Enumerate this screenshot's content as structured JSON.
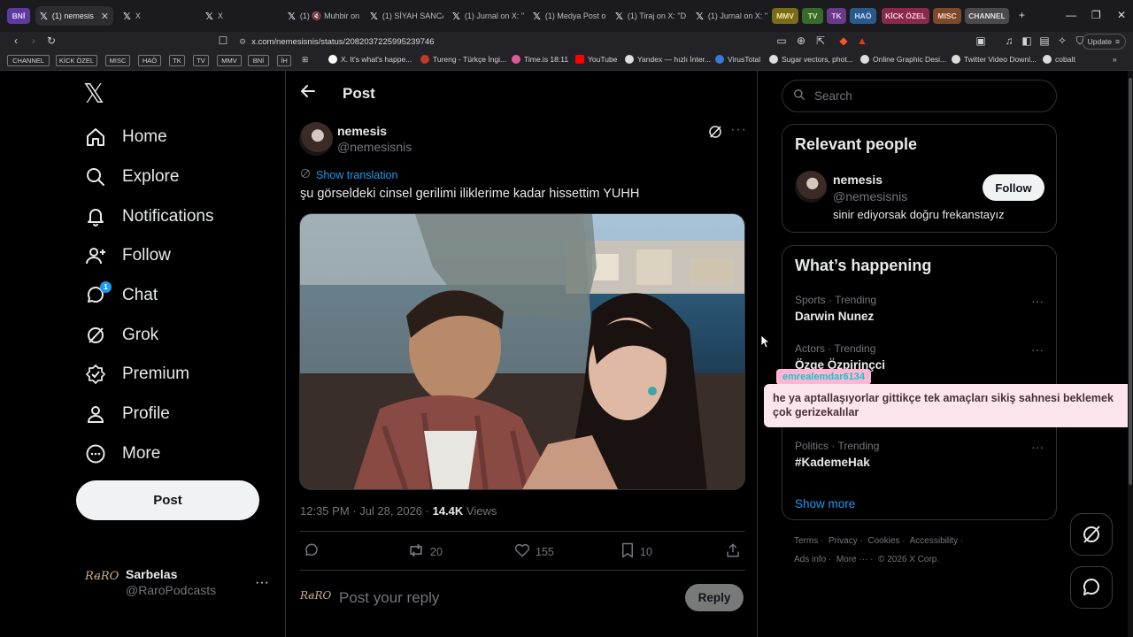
{
  "browser": {
    "tabs": [
      {
        "label": "BNİ",
        "kind": "chip",
        "color": "#5c3b9c"
      },
      {
        "label": "(1) nemesis",
        "active": true
      },
      {
        "label": "X"
      },
      {
        "label": "X"
      },
      {
        "label": "(1) 🔇 Muhbir on"
      },
      {
        "label": "(1) SİYAH SANCA"
      },
      {
        "label": "(1) Jurnal on X: \""
      },
      {
        "label": "(1) Medya Post o"
      },
      {
        "label": "(1) Tiraj on X: \"D"
      },
      {
        "label": "(1) Jurnal on X: \""
      }
    ],
    "group_chips": [
      {
        "label": "MMV",
        "color": "#7a6a1c"
      },
      {
        "label": "TV",
        "color": "#3a6a2a"
      },
      {
        "label": "TK",
        "color": "#6a3a8a"
      },
      {
        "label": "HAÖ",
        "color": "#2a5a8a"
      },
      {
        "label": "KİCK ÖZEL",
        "color": "#8a2a4a"
      },
      {
        "label": "MISC",
        "color": "#7a4a2a"
      },
      {
        "label": "CHANNEL",
        "color": "#4a4a4e"
      }
    ],
    "url": "x.com/nemesisnis/status/2082037225995239746",
    "update_label": "Update",
    "bookmark_chips": [
      "CHANNEL",
      "KİCK ÖZEL",
      "MISC",
      "HAÖ",
      "TK",
      "TV",
      "MMV",
      "BNİ",
      "İH"
    ],
    "bookmarks": [
      {
        "label": "X. It's what's happe...",
        "color": "#ffffff"
      },
      {
        "label": "Tureng - Türkçe İngi...",
        "color": "#c0392b"
      },
      {
        "label": "Time.is 18:11",
        "color": "#e05a9a"
      },
      {
        "label": "YouTube",
        "color": "#ff0000"
      },
      {
        "label": "Yandex — hızlı İnter...",
        "color": "#dddddd"
      },
      {
        "label": "VirusTotal",
        "color": "#3a78d8"
      },
      {
        "label": "Sugar vectors, phot...",
        "color": "#dddddd"
      },
      {
        "label": "Online Graphic Desi...",
        "color": "#dddddd"
      },
      {
        "label": "Twitter Video Downl...",
        "color": "#dddddd"
      },
      {
        "label": "cobalt",
        "color": "#dddddd"
      }
    ]
  },
  "nav": {
    "items": [
      {
        "label": "Home",
        "icon": "home-icon"
      },
      {
        "label": "Explore",
        "icon": "search-icon"
      },
      {
        "label": "Notifications",
        "icon": "bell-icon"
      },
      {
        "label": "Follow",
        "icon": "follow-icon"
      },
      {
        "label": "Chat",
        "icon": "chat-icon",
        "badge": "1"
      },
      {
        "label": "Grok",
        "icon": "grok-icon"
      },
      {
        "label": "Premium",
        "icon": "premium-icon"
      },
      {
        "label": "Profile",
        "icon": "profile-icon"
      },
      {
        "label": "More",
        "icon": "more-icon"
      }
    ],
    "post_label": "Post",
    "account": {
      "name": "Sarbelas",
      "handle": "@RaroPodcasts",
      "avatar_text": "Ra̶RO"
    }
  },
  "post": {
    "header_title": "Post",
    "author_name": "nemesis",
    "author_handle": "@nemesisnis",
    "translate_label": "Show translation",
    "text": "şu görseldeki cinsel gerilimi iliklerime kadar hissettim YUHH",
    "time": "12:35 PM · Jul 28, 2026 · ",
    "views_count": "14.4K",
    "views_label": " Views",
    "reposts": "20",
    "likes": "155",
    "bookmarks": "10",
    "reply_placeholder": "Post your reply",
    "reply_label": "Reply"
  },
  "sidebar": {
    "search_placeholder": "Search",
    "relevant_title": "Relevant people",
    "person": {
      "name": "nemesis",
      "handle": "@nemesisnis",
      "bio": "sinir ediyorsak doğru frekanstayız",
      "follow_label": "Follow"
    },
    "happening_title": "What’s happening",
    "trends": [
      {
        "category": "Sports · Trending",
        "name": "Darwin Nunez"
      },
      {
        "category": "Actors · Trending",
        "name": "Özge Özpirinçci"
      },
      {
        "category": "Politics · Trending",
        "name": "#KademeHak"
      }
    ],
    "show_more": "Show more",
    "footer_line1": [
      "Terms",
      "Privacy",
      "Cookies",
      "Accessibility"
    ],
    "footer_line2": [
      "Ads info",
      "More ···",
      "© 2026 X Corp."
    ]
  },
  "overlay": {
    "chat_username": "emrealemdar6134",
    "chat_message": "he ya aptallaşıyorlar gittikçe tek amaçları sikiş sahnesi beklemek çok gerizekalılar"
  }
}
